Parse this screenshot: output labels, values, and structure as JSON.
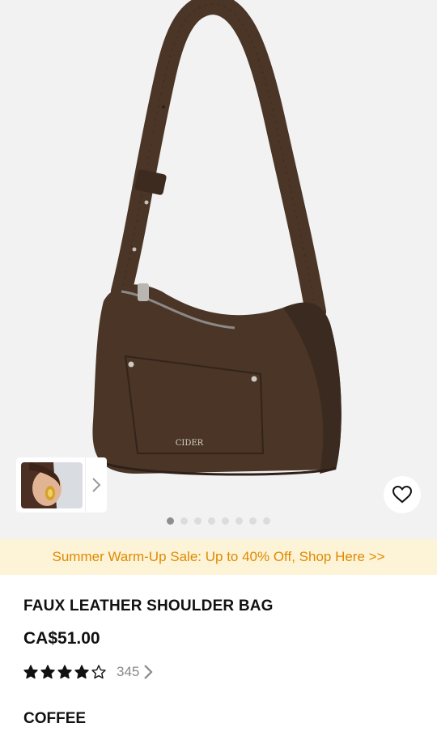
{
  "product": {
    "gallery": {
      "brand_mark": "CIDER",
      "total_images": 8,
      "active_index": 0
    },
    "promo_banner": "Summer Warm-Up Sale: Up to 40% Off, Shop Here >>",
    "title": "FAUX LEATHER SHOULDER BAG",
    "price": "CA$51.00",
    "rating": {
      "stars_filled": 4,
      "stars_total": 5,
      "review_count": "345"
    },
    "color_name": "COFFEE"
  },
  "colors": {
    "promo_bg": "#fdf3d6",
    "promo_text": "#e08a00",
    "bag_leather": "#4a3527"
  },
  "icons": {
    "favorite": "heart-outline-icon",
    "thumb_next": "chevron-right-icon",
    "reviews_more": "chevron-right-icon"
  }
}
